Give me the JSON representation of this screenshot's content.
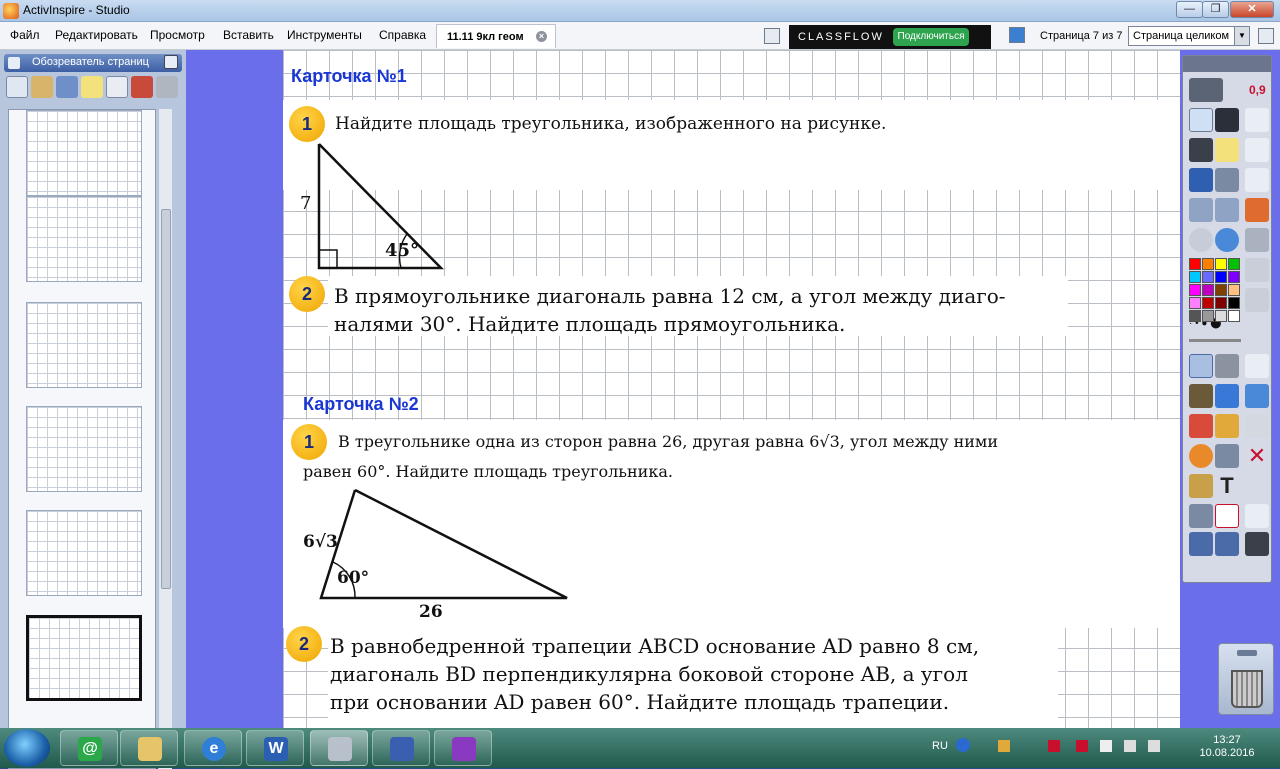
{
  "window": {
    "title": "ActivInspire - Studio",
    "minimize": "—",
    "restore": "❐",
    "close": "✕"
  },
  "menu": [
    "Файл",
    "Редактировать",
    "Просмотр",
    "Вставить",
    "Инструменты",
    "Справка"
  ],
  "document_tab": {
    "label": "11.11 9кл геом",
    "close": "×"
  },
  "classflow": {
    "brand": "CLASSFLOW",
    "connect_button": "Подключиться"
  },
  "page_indicator": "Страница 7 из 7",
  "zoom_select": {
    "value": "Страница целиком",
    "arrow": "▼"
  },
  "page_browser": {
    "title": "Обозреватель страниц",
    "active_page": 6
  },
  "toolbox": {
    "value_label": "0,9",
    "colors": [
      "#ff0000",
      "#ff8000",
      "#ffff00",
      "#00c000",
      "#00c8ff",
      "#6a6aff",
      "#0000ff",
      "#8000ff",
      "#ff00ff",
      "#c000c0",
      "#804000",
      "#ffc080",
      "#ff80ff",
      "#c00000",
      "#800000",
      "#000000",
      "#555555",
      "#999999",
      "#dddddd",
      "#ffffff"
    ]
  },
  "card1": {
    "heading": "Карточка №1",
    "task1": {
      "number": "1",
      "text": "Найдите площадь треугольника, изображенного на рисунке.",
      "side_label": "7",
      "angle_label": "45°"
    },
    "task2": {
      "number": "2",
      "line1": "В прямоугольнике диагональ равна 12 см, а угол между диаго-",
      "line2": "налями 30°. Найдите площадь прямоугольника."
    }
  },
  "card2": {
    "heading": "Карточка №2",
    "task1": {
      "number": "1",
      "line1": "В треугольнике одна из сторон равна 26, другая равна 6√3, угол между ними",
      "line2": "равен 60°. Найдите площадь треугольника.",
      "side_label": "6√3",
      "angle_label": "60°",
      "base_label": "26"
    },
    "task2": {
      "number": "2",
      "line1": "В равнобедренной трапеции ABCD основание AD равно 8 см,",
      "line2": "диагональ BD перпендикулярна боковой стороне AB, а угол",
      "line3": "при основании AD равен 60°. Найдите площадь трапеции."
    }
  },
  "taskbar": {
    "language": "RU",
    "time": "13:27",
    "date": "10.08.2016"
  }
}
